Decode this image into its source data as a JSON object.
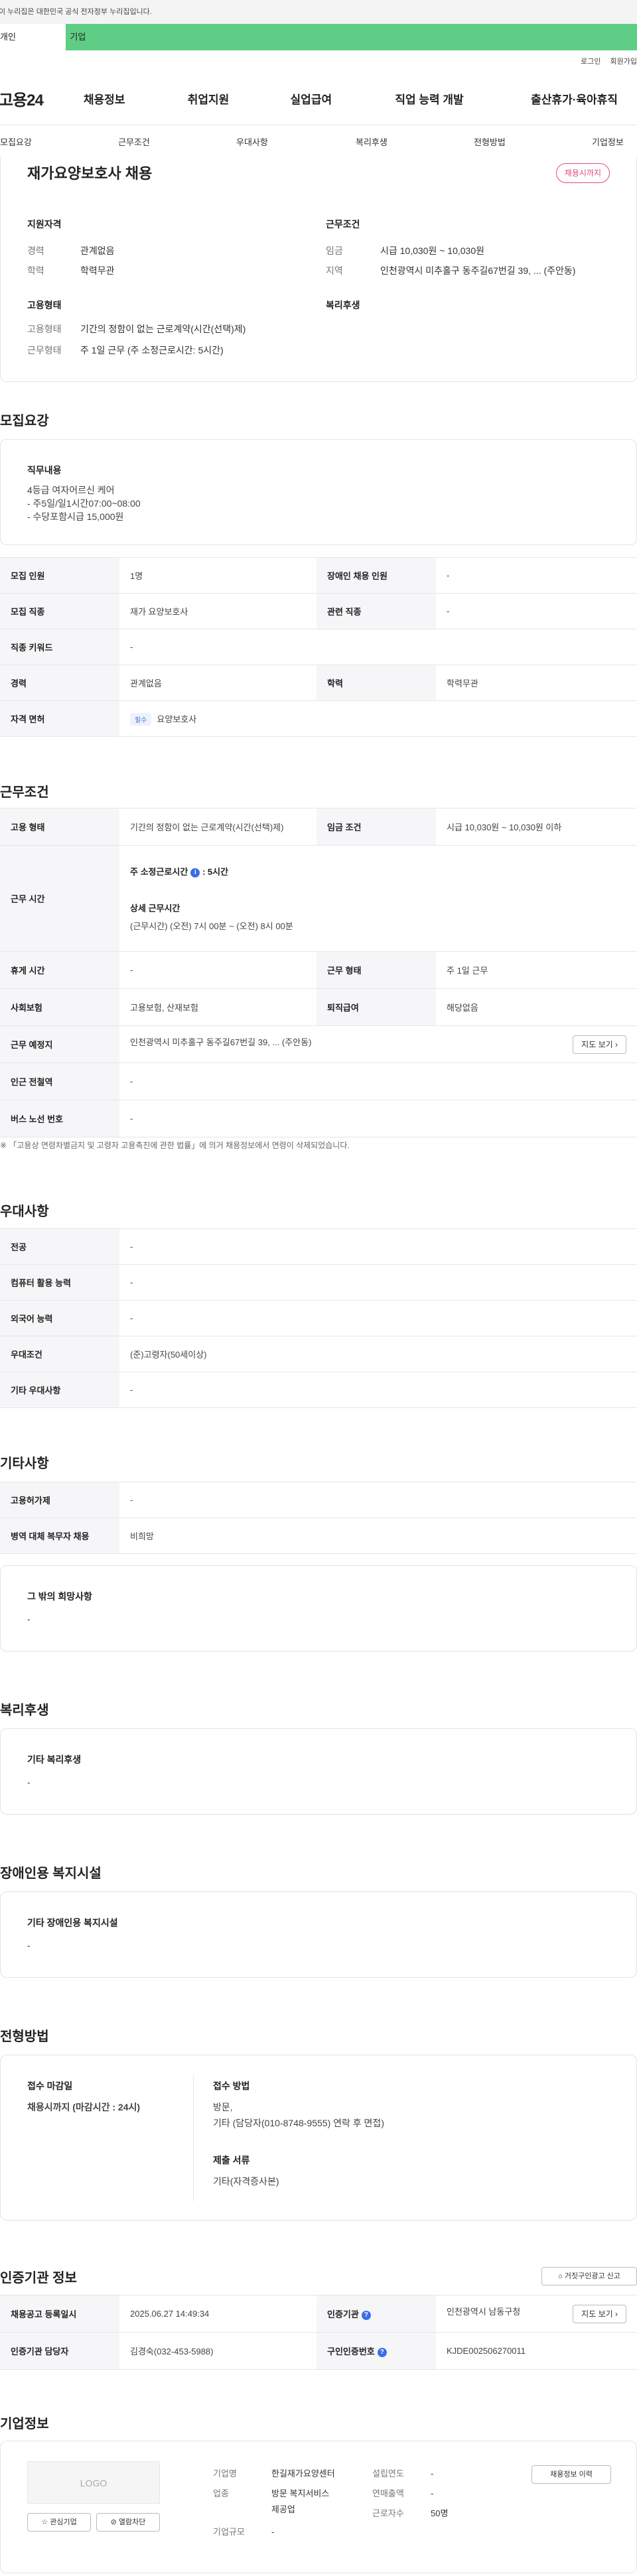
{
  "gov_banner": "이 누리집은 대한민국 공식 전자정부 누리집입니다.",
  "top_tabs": [
    "개인",
    "기업"
  ],
  "util": [
    "로그인",
    "회원가입"
  ],
  "logo": "고용24",
  "gnb": [
    "채용정보",
    "취업지원",
    "실업급여",
    "직업 능력 개발",
    "출산휴가·육아휴직"
  ],
  "subnav": [
    "모집요강",
    "근무조건",
    "우대사항",
    "복리후생",
    "전형방법",
    "기업정보"
  ],
  "summary": {
    "title": "재가요양보호사 채용",
    "badge": "채용시까지",
    "qual_label": "지원자격",
    "career_k": "경력",
    "career_v": "관계없음",
    "edu_k": "학력",
    "edu_v": "학력무관",
    "cond_label": "근무조건",
    "wage_k": "임금",
    "wage_v": "시급 10,030원 ~ 10,030원",
    "area_k": "지역",
    "area_v": "인천광역시 미추홀구 동주길67번길 39, ... (주안동)",
    "emp_label": "고용형태",
    "emptype_k": "고용형태",
    "emptype_v": "기간의 정함이 없는 근로계약(시간(선택)제)",
    "worktype_k": "근무형태",
    "worktype_v": "주 1일 근무 (주 소정근로시간: 5시간)",
    "welfare_label": "복리후생"
  },
  "recruit": {
    "heading": "모집요강",
    "duty_label": "직무내용",
    "duty_lines": [
      "4등급 여자어르신 케어",
      "- 주5일/일1시간07:00~08:00",
      "- 수당포함시급 15,000원"
    ],
    "rows": {
      "headcount_k": "모집 인원",
      "headcount_v": "1명",
      "disabled_k": "장애인 채용 인원",
      "disabled_v": "-",
      "job_k": "모집 직종",
      "job_v": "재가 요양보호사",
      "related_k": "관련 직종",
      "related_v": "-",
      "keyword_k": "직종 키워드",
      "keyword_v": "-",
      "career_k": "경력",
      "career_v": "관계없음",
      "edu_k": "학력",
      "edu_v": "학력무관",
      "license_k": "자격 면허",
      "license_tag": "필수",
      "license_v": "요양보호사"
    }
  },
  "work": {
    "heading": "근무조건",
    "emptype_k": "고용 형태",
    "emptype_v": "기간의 정함이 없는 근로계약(시간(선택)제)",
    "wage_k": "임금 조건",
    "wage_v": "시급 10,030원 ~ 10,030원 이하",
    "hours_k": "근무 시간",
    "hours_title": "주 소정근로시간",
    "hours_val": ": 5시간",
    "hours_detail_title": "상세 근무시간",
    "hours_detail": "(근무시간) (오전) 7시 00분 ~ (오전) 8시 00분",
    "rest_k": "휴게 시간",
    "rest_v": "-",
    "shift_k": "근무 형태",
    "shift_v": "주 1일 근무",
    "insurance_k": "사회보험",
    "insurance_v": "고용보험, 산재보험",
    "severance_k": "퇴직급여",
    "severance_v": "해당없음",
    "place_k": "근무 예정지",
    "place_v": "인천광역시 미추홀구 동주길67번길 39, ... (주안동)",
    "map_btn": "지도 보기",
    "subway_k": "인근 전철역",
    "subway_v": "-",
    "bus_k": "버스 노선 번호",
    "bus_v": "-",
    "note": "※ 「고용상 연령차별금지 및 고령자 고용촉진에 관한 법률」에 의거 채용정보에서 연령이 삭제되었습니다."
  },
  "pref": {
    "heading": "우대사항",
    "major_k": "전공",
    "major_v": "-",
    "pc_k": "컴퓨터 활용 능력",
    "pc_v": "-",
    "lang_k": "외국어 능력",
    "lang_v": "-",
    "cond_k": "우대조건",
    "cond_v": "(준)고령자(50세이상)",
    "etc_k": "기타 우대사항",
    "etc_v": "-"
  },
  "other": {
    "heading": "기타사항",
    "device_k": "고용허가제",
    "device_v": "-",
    "military_k": "병역 대체 복무자 채용",
    "military_v": "비희망",
    "hope_label": "그 밖의 희망사항",
    "hope_v": "-"
  },
  "welfare": {
    "heading": "복리후생",
    "label": "기타 복리후생",
    "value": "-"
  },
  "disabled": {
    "heading": "장애인용 복지시설",
    "label": "기타 장애인용 복지시설",
    "value": "-"
  },
  "selection": {
    "heading": "전형방법",
    "deadline_label": "접수 마감일",
    "deadline_v": "채용시까지 (마감시간 : 24시)",
    "method_label": "접수 방법",
    "method_v1": "방문,",
    "method_v2": "기타 (담당자(010-8748-9555) 연락 후 면접)",
    "docs_label": "제출 서류",
    "docs_v": "기타(자격증사본)"
  },
  "cert": {
    "heading": "인증기관 정보",
    "report_btn": "거짓구인광고 신고",
    "reg_k": "채용공고 등록일시",
    "reg_v": "2025.06.27 14:49:34",
    "org_k": "인증기관",
    "org_v": "인천광역시 남동구청",
    "map_btn": "지도 보기",
    "manager_k": "인증기관 담당자",
    "manager_v": "김경숙(032-453-5988)",
    "job_no_k": "구인인증번호",
    "job_no_v": "KJDE002506270011"
  },
  "company": {
    "heading": "기업정보",
    "logo_text": "LOGO",
    "fav_btn": "관심기업",
    "block_btn": "열람차단",
    "name_k": "기업명",
    "name_v": "한길재가요양센터",
    "founded_k": "설립연도",
    "founded_v": "-",
    "industry_k": "업종",
    "industry_v1": "방문 복지서비스",
    "industry_v2": "제공업",
    "revenue_k": "연매출액",
    "revenue_v": "-",
    "employees_k": "근로자수",
    "employees_v": "50명",
    "size_k": "기업규모",
    "size_v": "-",
    "history_btn": "채용정보 이력"
  }
}
